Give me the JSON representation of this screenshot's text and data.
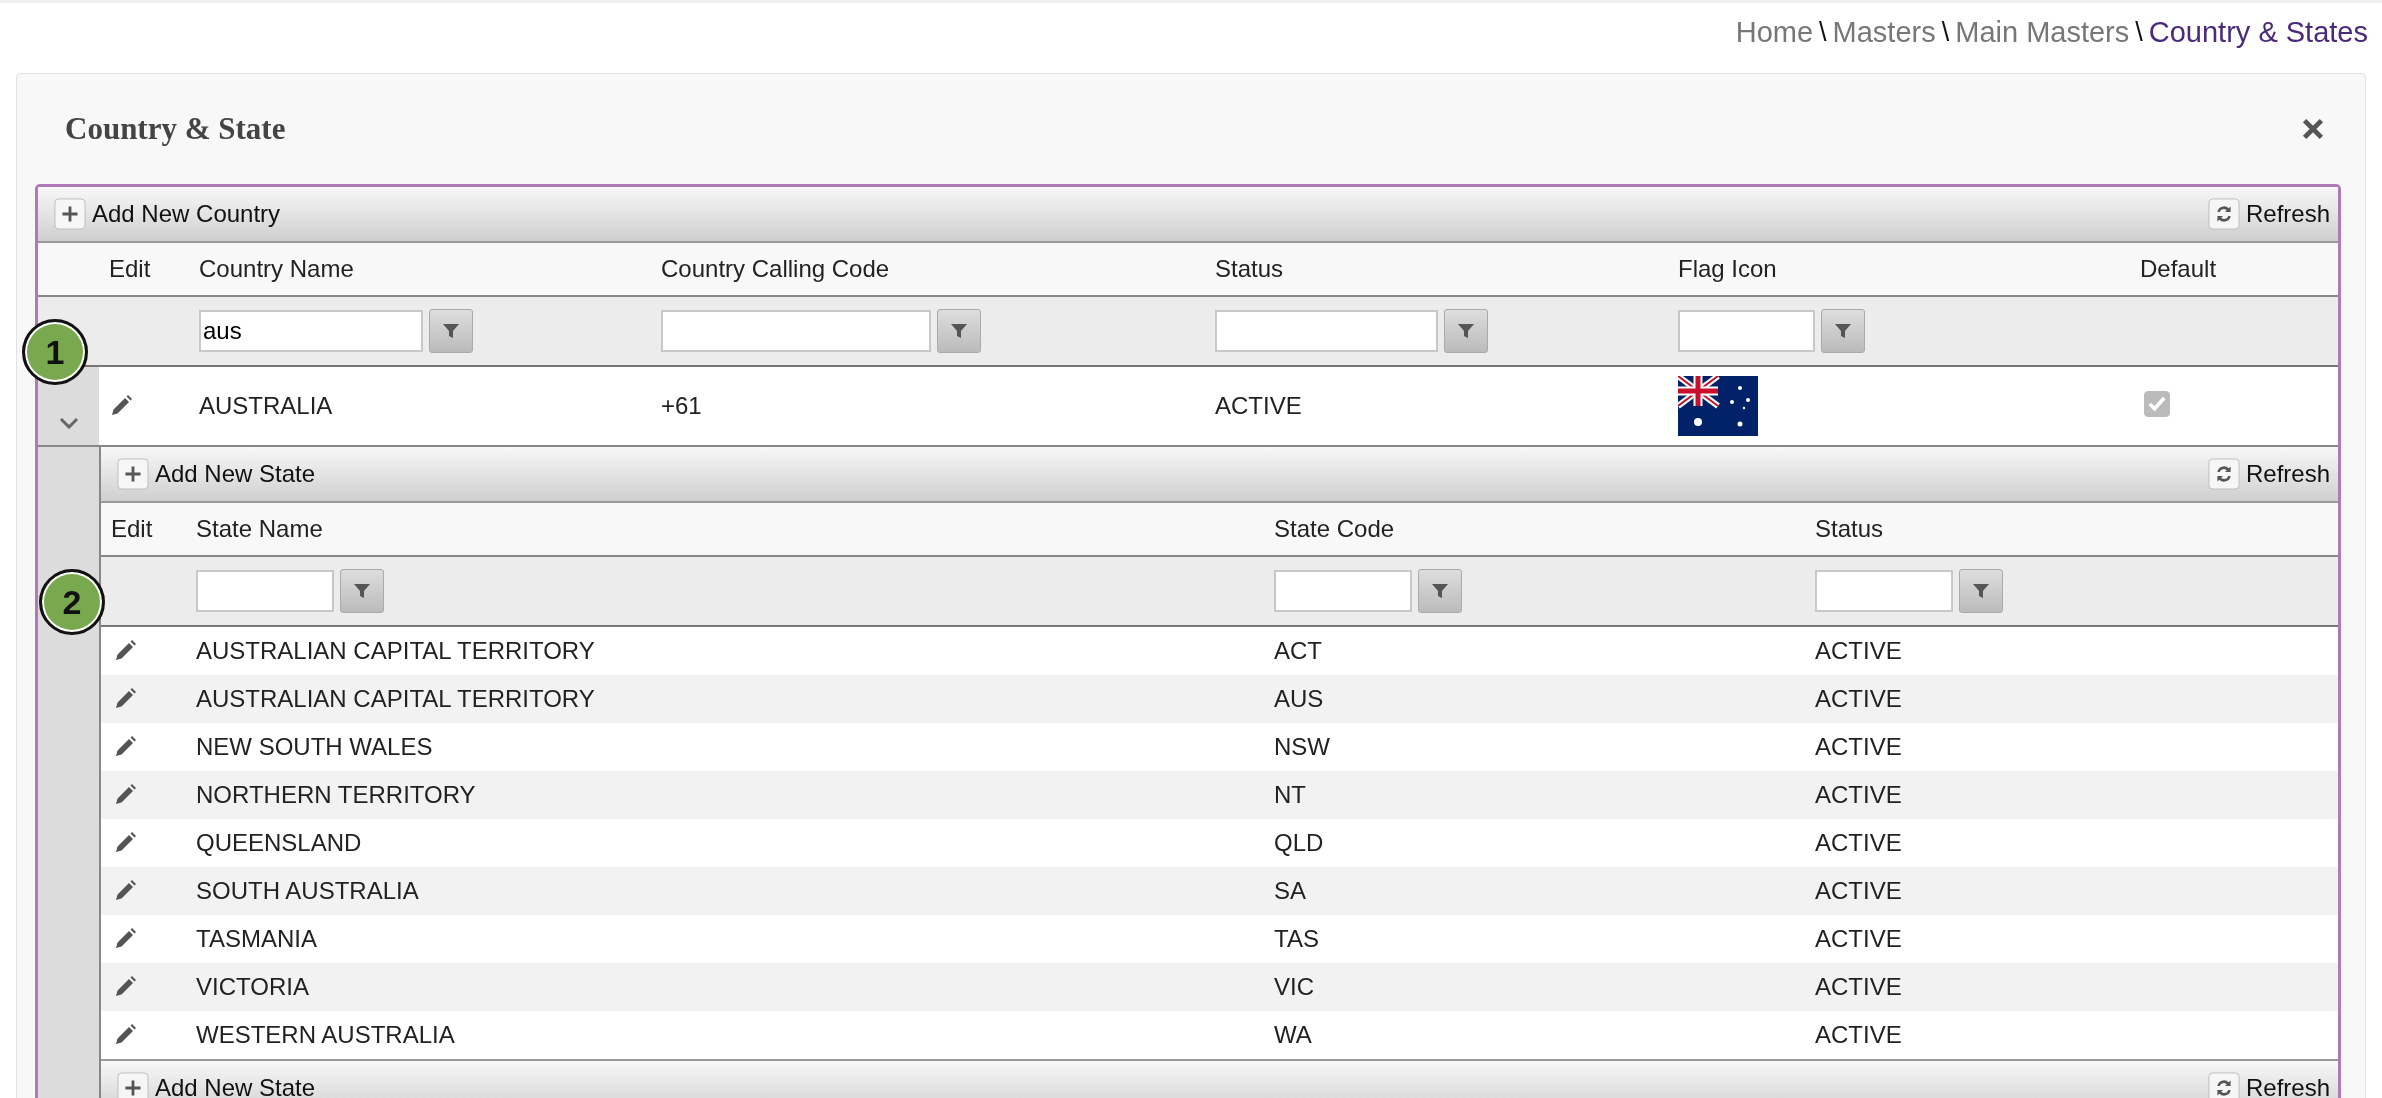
{
  "breadcrumb": [
    {
      "label": "Home",
      "current": false
    },
    {
      "label": "Masters",
      "current": false
    },
    {
      "label": "Main Masters",
      "current": false
    },
    {
      "label": "Country & States",
      "current": true
    }
  ],
  "separator": "\\",
  "panel": {
    "title": "Country & State"
  },
  "country_grid": {
    "toolbar": {
      "add_label": "Add New Country",
      "refresh_label": "Refresh"
    },
    "columns": [
      "Edit",
      "Country Name",
      "Country Calling Code",
      "Status",
      "Flag Icon",
      "Default"
    ],
    "name_filter": "aus",
    "marker": "1",
    "rows": [
      {
        "expanded": true,
        "name": "AUSTRALIA",
        "calling_code": "+61",
        "status": "ACTIVE",
        "default": {
          "checked": true,
          "disabled": true
        },
        "states_grid": {
          "toolbar": {
            "add_label": "Add New State",
            "refresh_label": "Refresh"
          },
          "columns": [
            "Edit",
            "State Name",
            "State Code",
            "Status"
          ],
          "marker": "2",
          "rows": [
            {
              "name": "AUSTRALIAN CAPITAL TERRITORY",
              "code": "ACT",
              "status": "ACTIVE"
            },
            {
              "name": "AUSTRALIAN CAPITAL TERRITORY",
              "code": "AUS",
              "status": "ACTIVE"
            },
            {
              "name": "NEW SOUTH WALES",
              "code": "NSW",
              "status": "ACTIVE"
            },
            {
              "name": "NORTHERN TERRITORY",
              "code": "NT",
              "status": "ACTIVE"
            },
            {
              "name": "QUEENSLAND",
              "code": "QLD",
              "status": "ACTIVE"
            },
            {
              "name": "SOUTH AUSTRALIA",
              "code": "SA",
              "status": "ACTIVE"
            },
            {
              "name": "TASMANIA",
              "code": "TAS",
              "status": "ACTIVE"
            },
            {
              "name": "VICTORIA",
              "code": "VIC",
              "status": "ACTIVE"
            },
            {
              "name": "WESTERN AUSTRALIA",
              "code": "WA",
              "status": "ACTIVE"
            }
          ],
          "footer_toolbar": {
            "add_label": "Add New State",
            "refresh_label": "Refresh"
          }
        }
      }
    ]
  }
}
